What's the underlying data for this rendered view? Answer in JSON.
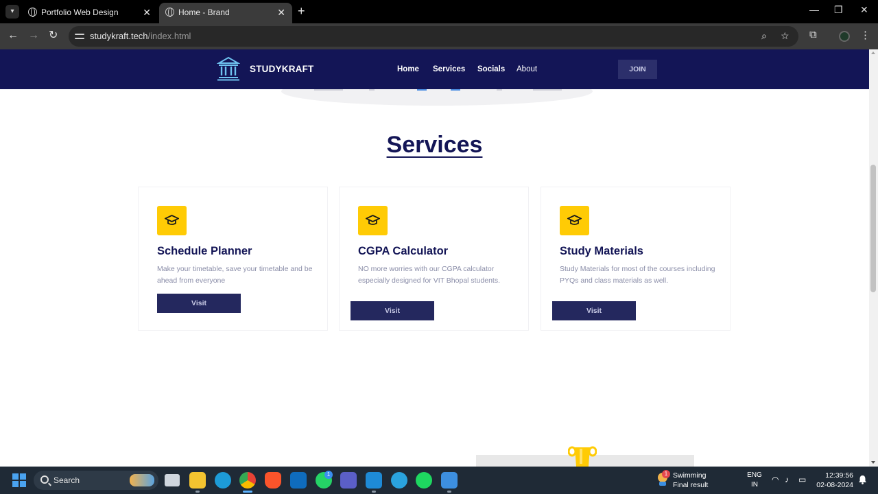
{
  "browser": {
    "tabs": [
      {
        "title": "Portfolio Web Design",
        "active": false
      },
      {
        "title": "Home - Brand",
        "active": true
      }
    ],
    "url": {
      "host": "studykraft.tech",
      "path": "/index.html"
    }
  },
  "site": {
    "brand": "STUDYKRAFT",
    "nav": [
      "Home",
      "Services",
      "Socials",
      "About"
    ],
    "join_label": "JOIN",
    "colors": {
      "navy": "#131556",
      "accent": "#ffcb05",
      "button": "#24285e"
    }
  },
  "services": {
    "heading": "Services",
    "cards": [
      {
        "icon": "graduation-cap-icon",
        "title": "Schedule Planner",
        "description": "Make your timetable, save your timetable and be ahead from everyone",
        "button": "Visit"
      },
      {
        "icon": "graduation-cap-icon",
        "title": "CGPA Calculator",
        "description": "NO more worries with our CGPA calculator especially designed for VIT Bhopal students.",
        "button": "Visit"
      },
      {
        "icon": "graduation-cap-icon",
        "title": "Study Materials",
        "description": "Study Materials for most of the courses including PYQs and class materials as well.",
        "button": "Visit"
      }
    ]
  },
  "taskbar": {
    "search_label": "Search",
    "badges": {
      "whatsapp": "1",
      "weather": "1"
    },
    "weather": {
      "line1": "Swimming",
      "line2": "Final result"
    },
    "language": {
      "line1": "ENG",
      "line2": "IN"
    },
    "time": "12:39:56",
    "date": "02-08-2024"
  }
}
